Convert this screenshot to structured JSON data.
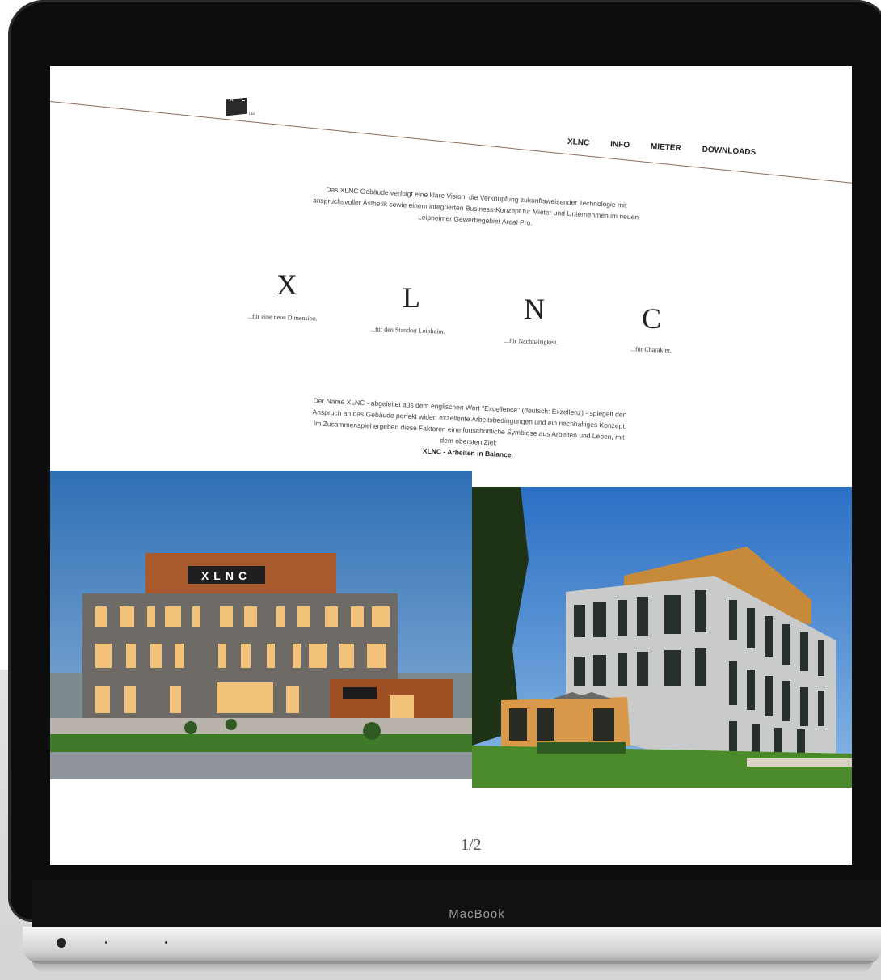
{
  "device": {
    "brand_label": "MacBook"
  },
  "site": {
    "logo": {
      "mark_text": "X L N C",
      "sub_text": "LEI"
    },
    "nav": [
      "XLNC",
      "INFO",
      "MIETER",
      "DOWNLOADS"
    ],
    "intro_text": "Das XLNC Gebäude verfolgt eine klare Vision: die Verknüpfung zukunftsweisender Technologie mit anspruchsvoller Ästhetik sowie einem integrierten Business-Konzept für Mieter und Unternehmen im neuen Leipheimer Gewerbegebiet Areal Pro.",
    "pillars": [
      {
        "letter": "X",
        "tagline": "...für eine neue Dimension."
      },
      {
        "letter": "L",
        "tagline": "...für den Standort Leipheim."
      },
      {
        "letter": "N",
        "tagline": "...für Nachhaltigkeit."
      },
      {
        "letter": "C",
        "tagline": "...für Charakter."
      }
    ],
    "story_text": "Der Name XLNC - abgeleitet aus dem englischen Wort \"Excellence\" (deutsch: Exzellenz) - spiegelt den Anspruch an das Gebäude perfekt wider: exzellente Arbeitsbedingungen und ein nachhaltiges Konzept. Im Zusammenspiel ergeben diese Faktoren eine fortschrittliche Symbiose aus Arbeiten und Leben, mit dem obersten Ziel:",
    "story_bold": "XLNC - Arbeiten in Balance.",
    "building_sign": "XLNC",
    "pager": "1/2",
    "colors": {
      "accent_rule": "#8a6a5a",
      "text": "#444444"
    }
  }
}
